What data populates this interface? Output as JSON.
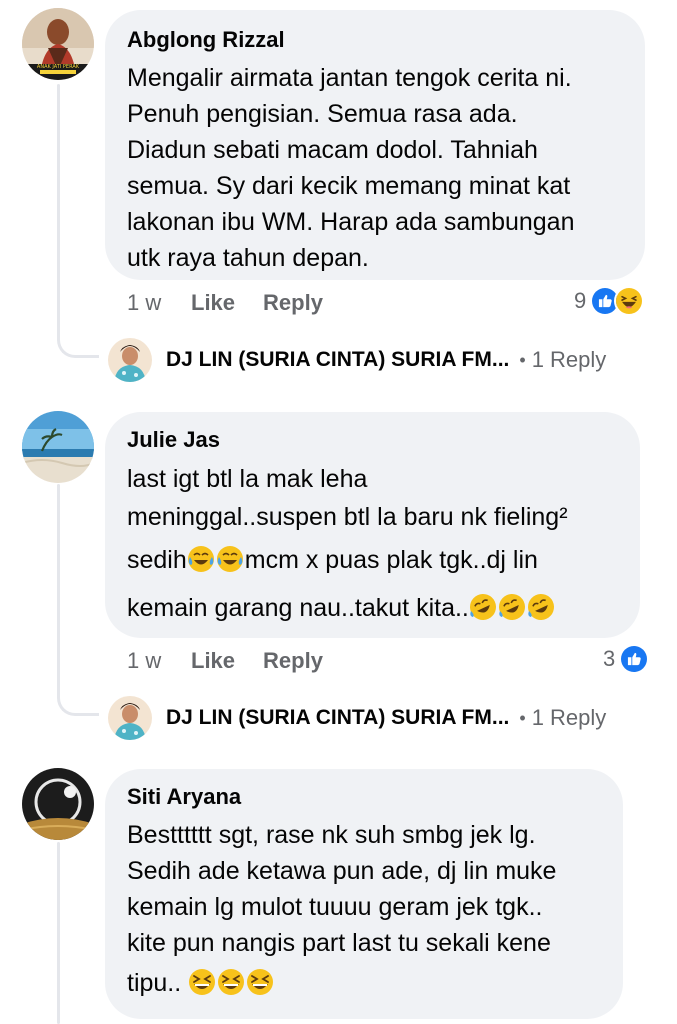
{
  "comments": [
    {
      "author": "Abglong Rizzal",
      "lines": [
        "Mengalir airmata jantan tengok cerita ni.",
        "Penuh pengisian. Semua rasa ada.",
        "Diadun sebati macam dodol. Tahniah",
        "semua. Sy dari kecik memang minat kat",
        "lakonan ibu WM. Harap ada sambungan",
        "utk raya tahun depan."
      ],
      "age": "1 w",
      "like_label": "Like",
      "reply_label": "Reply",
      "reaction_count": "9",
      "avatar_caption": "ANAK JATI PERAK",
      "reply_preview": {
        "name": "DJ LIN (SURIA CINTA) SURIA FM...",
        "count": "1 Reply"
      }
    },
    {
      "author": "Julie Jas",
      "lines": [
        "last igt btl la mak leha",
        "meninggal..suspen btl la baru nk fieling²",
        "sedih",
        "mcm x puas plak tgk..dj lin",
        "kemain garang nau..takut kita.."
      ],
      "age": "1 w",
      "like_label": "Like",
      "reply_label": "Reply",
      "reaction_count": "3",
      "reply_preview": {
        "name": "DJ LIN (SURIA CINTA) SURIA FM...",
        "count": "1 Reply"
      }
    },
    {
      "author": "Siti Aryana",
      "lines": [
        "Bestttttt sgt, rase nk suh smbg jek lg.",
        "Sedih ade ketawa pun ade, dj lin muke",
        "kemain lg mulot tuuuu geram jek tgk..",
        "kite pun nangis part last tu sekali kene",
        "tipu.."
      ]
    }
  ],
  "icons": {
    "like": "like-reaction-icon",
    "haha": "haha-reaction-icon",
    "tears": "tears-of-joy-emoji",
    "rofl": "rolling-laughing-emoji",
    "grin": "grinning-squinting-emoji"
  },
  "colors": {
    "bubble": "#f0f2f5",
    "meta_text": "#65676b",
    "like_blue": "#1877f2",
    "emoji_yellow": "#f7c21b"
  }
}
